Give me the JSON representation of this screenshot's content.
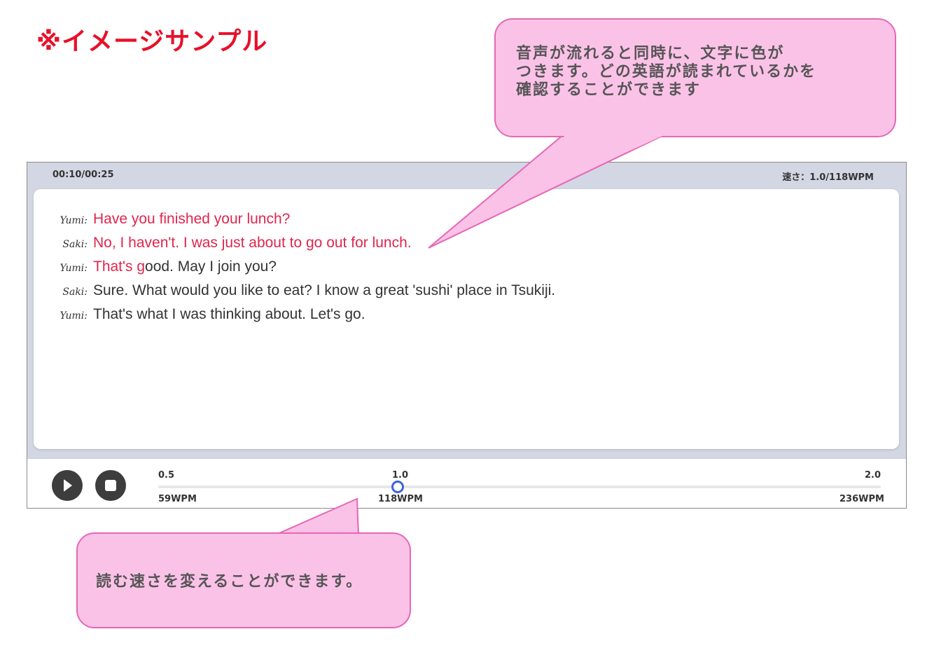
{
  "sample_title": "※イメージサンプル",
  "player": {
    "time": "00:10/00:25",
    "speed_readout": "速さ：1.0/118WPM",
    "transcript": [
      {
        "speaker": "Yumi:",
        "highlighted": "Have you finished your lunch?",
        "rest": ""
      },
      {
        "speaker": "Saki:",
        "highlighted": "No, I haven't. I was just about to go out for lunch.",
        "rest": ""
      },
      {
        "speaker": "Yumi:",
        "highlighted": "That's g",
        "rest": "ood. May I join you?"
      },
      {
        "speaker": "Saki:",
        "highlighted": "",
        "rest": "Sure. What would you like  to eat? I know a great 'sushi' place in Tsukiji."
      },
      {
        "speaker": "Yumi:",
        "highlighted": "",
        "rest": "That's what I was thinking about. Let's go."
      }
    ],
    "controls": {
      "play_icon": "play-icon",
      "stop_icon": "stop-icon",
      "slider": {
        "top_labels": {
          "min": "0.5",
          "mid": "1.0",
          "max": "2.0"
        },
        "bottom_labels": {
          "min": "59WPM",
          "mid": "118WPM",
          "max": "236WPM"
        },
        "value": 1.0
      }
    },
    "colors": {
      "highlight": "#e0254d",
      "accent": "#3c63d8"
    }
  },
  "callouts": {
    "top": "音声が流れると同時に、文字に色が\nつきます。どの英語が読まれているかを\n確認することができます",
    "bottom": "読む速さを変えることができます。"
  }
}
